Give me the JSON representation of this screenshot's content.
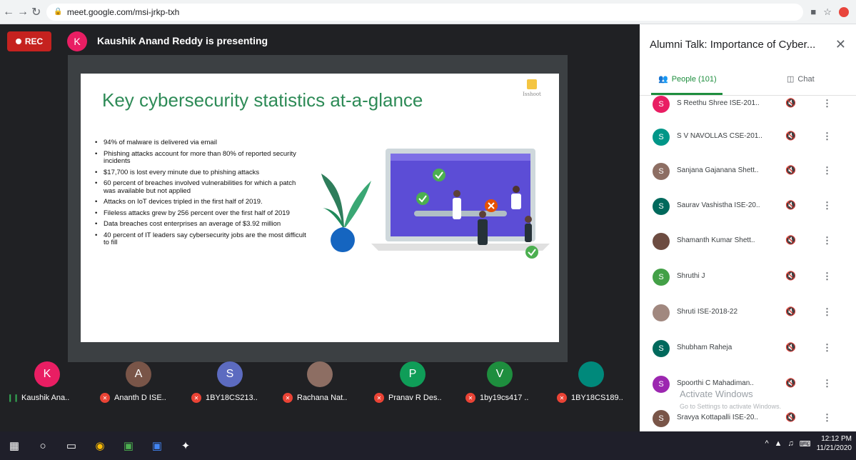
{
  "browser": {
    "url": "meet.google.com/msi-jrkp-txh",
    "icons": [
      "back-icon",
      "forward-icon",
      "reload-icon",
      "lock-icon",
      "star-icon",
      "extension-icon",
      "menu-icon"
    ]
  },
  "meet": {
    "rec_label": "REC",
    "presenter_initial": "K",
    "presenter_text": "Kaushik Anand Reddy is presenting"
  },
  "slide": {
    "title": "Key cybersecurity statistics at-a-glance",
    "logo_text": "Isshoot",
    "bullets": [
      "94% of malware is delivered via email",
      "Phishing attacks account for more than 80% of reported security incidents",
      "$17,700 is lost every minute due to phishing attacks",
      "60 percent of breaches involved vulnerabilities for which a patch was available but not applied",
      "Attacks on IoT devices tripled in the first half of 2019.",
      "Fileless attacks grew by 256 percent over the first half of 2019",
      "Data breaches cost enterprises an average of $3.92 million",
      "40 percent of IT leaders say cybersecurity jobs are the most difficult to fill"
    ]
  },
  "tiles": [
    {
      "initial": "K",
      "color": "#e91e63",
      "name": "Kaushik Ana..",
      "speaking": true
    },
    {
      "initial": "A",
      "color": "#795548",
      "name": "Ananth D ISE..",
      "speaking": false
    },
    {
      "initial": "S",
      "color": "#5c6bc0",
      "name": "1BY18CS213..",
      "speaking": false
    },
    {
      "initial": "",
      "color": "#8d6e63",
      "name": "Rachana Nat..",
      "speaking": false
    },
    {
      "initial": "P",
      "color": "#0f9d58",
      "name": "Pranav R Des..",
      "speaking": false
    },
    {
      "initial": "V",
      "color": "#1e8e3e",
      "name": "1by19cs417 ..",
      "speaking": false
    },
    {
      "initial": "",
      "color": "#00897b",
      "name": "1BY18CS189..",
      "speaking": false
    }
  ],
  "panel": {
    "title": "Alumni Talk: Importance of Cyber...",
    "people_tab": "People (101)",
    "chat_tab": "Chat",
    "people": [
      {
        "initial": "S",
        "color": "#e91e63",
        "name": "S Reethu Shree ISE-201.."
      },
      {
        "initial": "S",
        "color": "#009688",
        "name": "S V NAVOLLAS CSE-201.."
      },
      {
        "initial": "S",
        "color": "#8d6e63",
        "name": "Sanjana Gajanana Shett.."
      },
      {
        "initial": "S",
        "color": "#00695c",
        "name": "Saurav Vashistha ISE-20.."
      },
      {
        "initial": "",
        "color": "#6d4c41",
        "name": "Shamanth Kumar Shett.."
      },
      {
        "initial": "S",
        "color": "#43a047",
        "name": "Shruthi J"
      },
      {
        "initial": "",
        "color": "#a1887f",
        "name": "Shruti ISE-2018-22"
      },
      {
        "initial": "S",
        "color": "#00695c",
        "name": "Shubham Raheja"
      },
      {
        "initial": "S",
        "color": "#9c27b0",
        "name": "Spoorthi C Mahadiman.."
      },
      {
        "initial": "S",
        "color": "#795548",
        "name": "Sravya Kottapalli ISE-20.."
      }
    ],
    "watermark_title": "Activate Windows",
    "watermark_sub": "Go to Settings to activate Windows."
  },
  "taskbar": {
    "time": "12:12 PM",
    "date": "11/21/2020"
  }
}
